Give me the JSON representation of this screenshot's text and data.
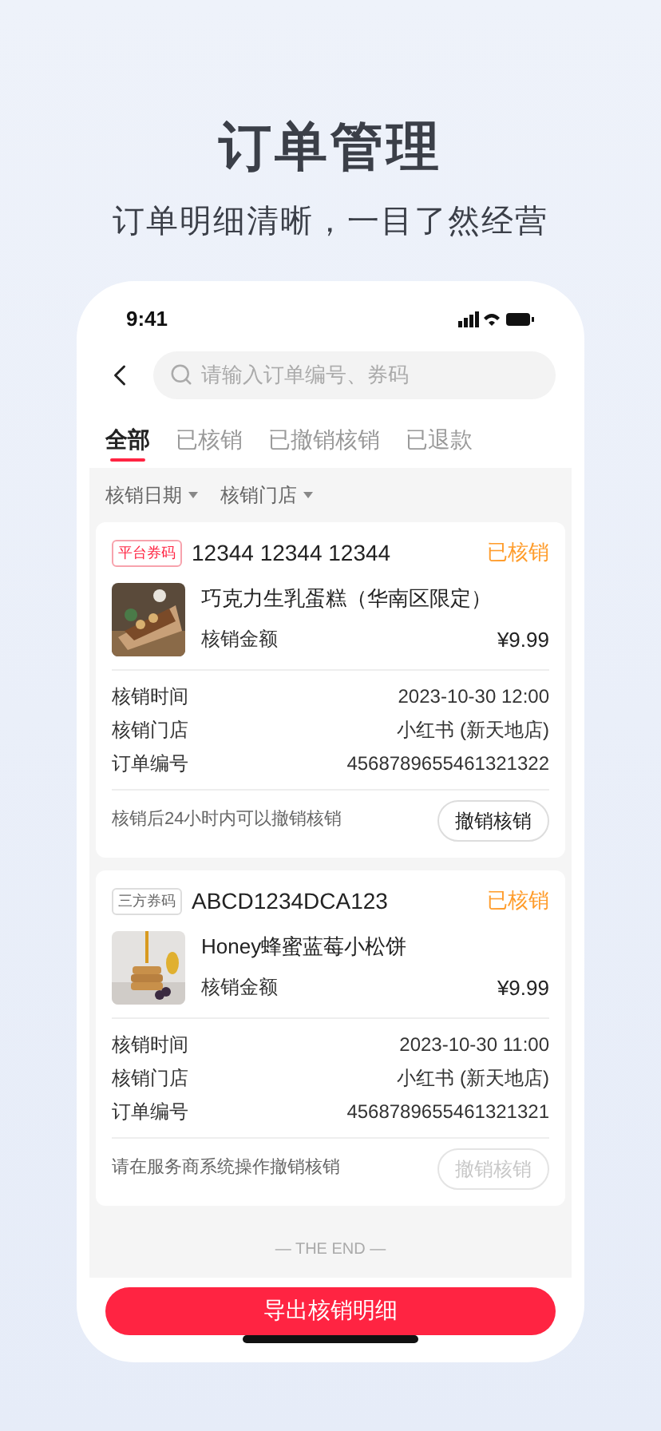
{
  "headline": "订单管理",
  "subtitle": "订单明细清晰，一目了然经营",
  "status_bar": {
    "time": "9:41"
  },
  "search": {
    "placeholder": "请输入订单编号、券码"
  },
  "tabs": [
    {
      "label": "全部",
      "selected": true
    },
    {
      "label": "已核销",
      "selected": false
    },
    {
      "label": "已撤销核销",
      "selected": false
    },
    {
      "label": "已退款",
      "selected": false
    }
  ],
  "filters": [
    "核销日期",
    "核销门店"
  ],
  "orders": [
    {
      "tag": {
        "label": "平台券码",
        "kind": "platform"
      },
      "code": "12344 12344 12344",
      "status": "已核销",
      "product": "巧克力生乳蛋糕（华南区限定）",
      "amount_label": "核销金额",
      "amount": "¥9.99",
      "details": [
        {
          "label": "核销时间",
          "value": "2023-10-30 12:00"
        },
        {
          "label": "核销门店",
          "value": "小红书 (新天地店)"
        },
        {
          "label": "订单编号",
          "value": "4568789655461321322"
        }
      ],
      "note": "核销后24小时内可以撤销核销",
      "action": "撤销核销",
      "action_disabled": false
    },
    {
      "tag": {
        "label": "三方券码",
        "kind": "third_party"
      },
      "code": "ABCD1234DCA123",
      "status": "已核销",
      "product": "Honey蜂蜜蓝莓小松饼",
      "amount_label": "核销金额",
      "amount": "¥9.99",
      "details": [
        {
          "label": "核销时间",
          "value": "2023-10-30 11:00"
        },
        {
          "label": "核销门店",
          "value": "小红书 (新天地店)"
        },
        {
          "label": "订单编号",
          "value": "4568789655461321321"
        }
      ],
      "note": "请在服务商系统操作撤销核销",
      "action": "撤销核销",
      "action_disabled": true
    }
  ],
  "end_text": "— THE END —",
  "export_button": "导出核销明细"
}
